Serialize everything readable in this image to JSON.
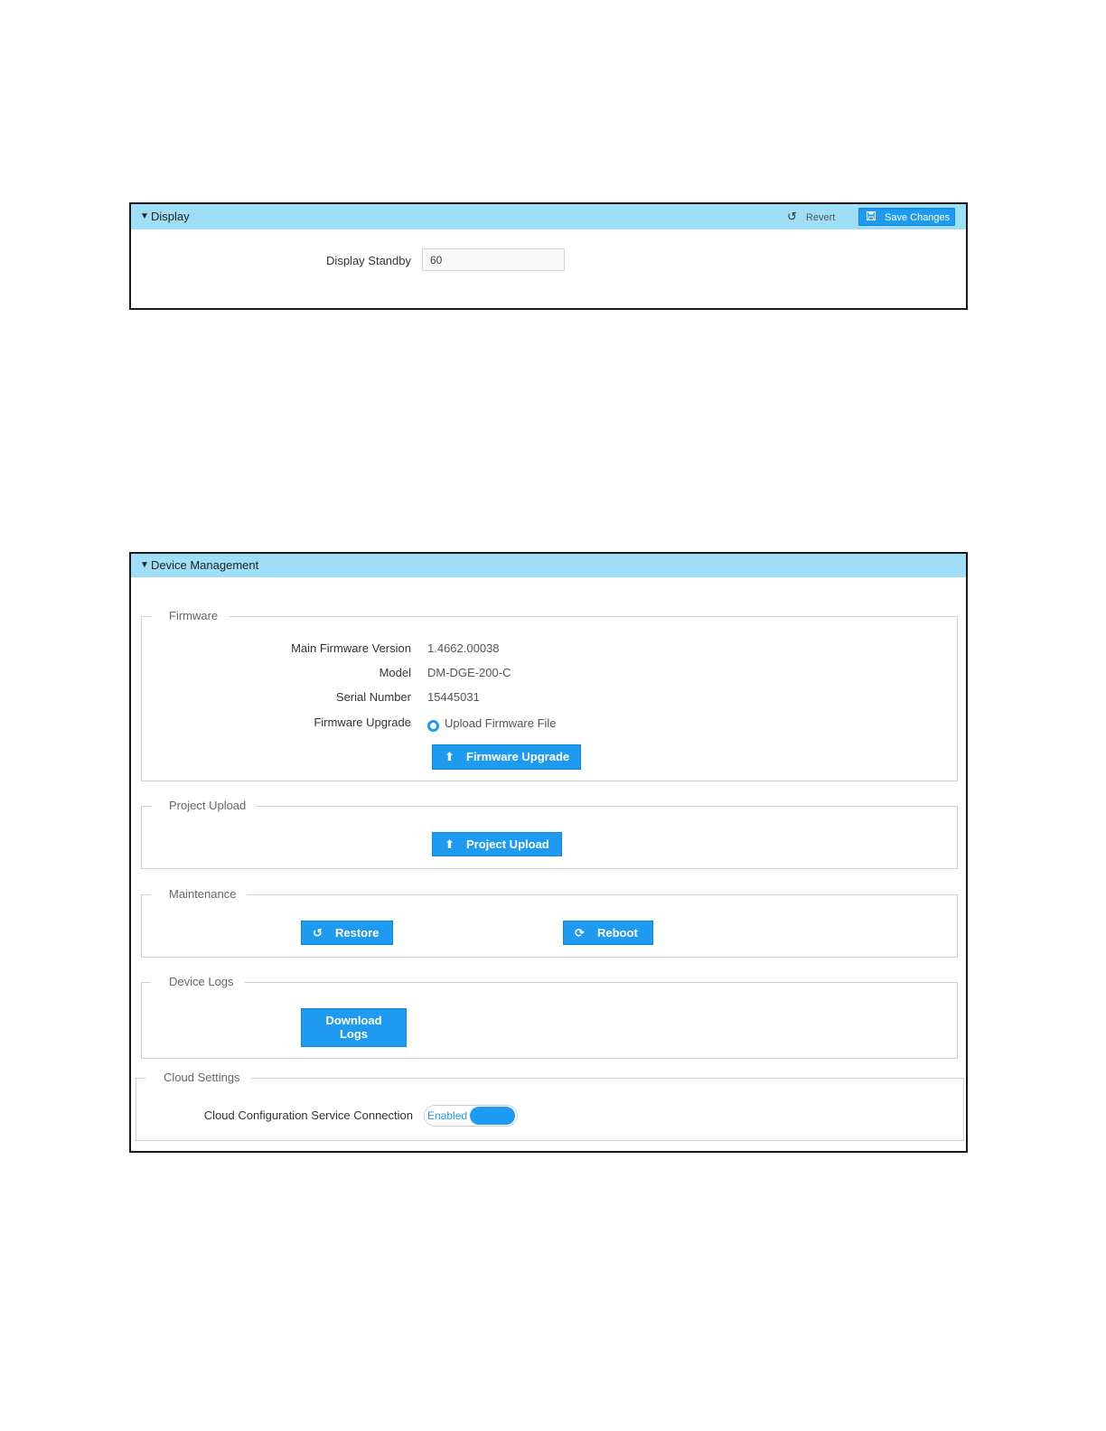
{
  "display_panel": {
    "title": "Display",
    "revert_label": "Revert",
    "save_label": "Save Changes",
    "standby_label": "Display Standby",
    "standby_value": "60"
  },
  "device_panel": {
    "title": "Device Management",
    "firmware": {
      "legend": "Firmware",
      "main_version_label": "Main Firmware Version",
      "main_version_value": "1.4662.00038",
      "model_label": "Model",
      "model_value": "DM-DGE-200-C",
      "serial_label": "Serial Number",
      "serial_value": "15445031",
      "upgrade_label": "Firmware Upgrade",
      "upload_option": "Upload Firmware File",
      "upgrade_button": "Firmware Upgrade"
    },
    "project_upload": {
      "legend": "Project Upload",
      "button": "Project Upload"
    },
    "maintenance": {
      "legend": "Maintenance",
      "restore_button": "Restore",
      "reboot_button": "Reboot"
    },
    "device_logs": {
      "legend": "Device Logs",
      "download_line1": "Download",
      "download_line2": "Logs"
    },
    "cloud_settings": {
      "legend": "Cloud Settings",
      "connection_label": "Cloud Configuration Service Connection",
      "toggle_state": "Enabled"
    }
  },
  "colors": {
    "header_bg": "#9edff7",
    "accent": "#1e9bf0"
  }
}
